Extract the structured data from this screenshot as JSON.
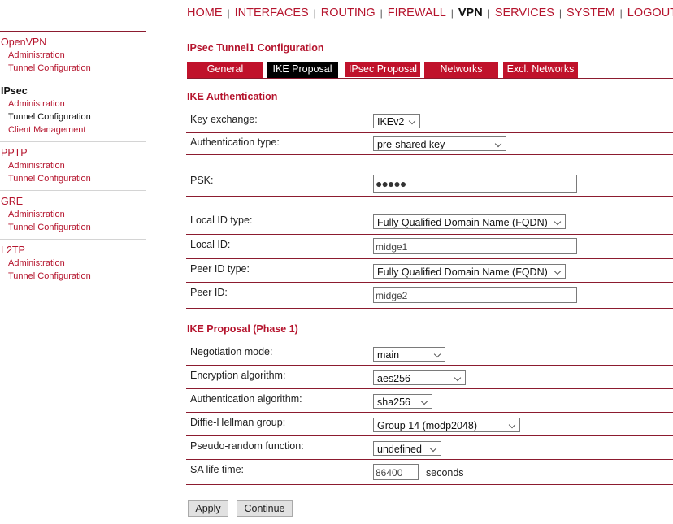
{
  "topnav": {
    "items": [
      {
        "label": "HOME",
        "active": false
      },
      {
        "label": "INTERFACES",
        "active": false
      },
      {
        "label": "ROUTING",
        "active": false
      },
      {
        "label": "FIREWALL",
        "active": false
      },
      {
        "label": "VPN",
        "active": true
      },
      {
        "label": "SERVICES",
        "active": false
      },
      {
        "label": "SYSTEM",
        "active": false
      },
      {
        "label": "LOGOUT",
        "active": false
      }
    ],
    "separator": "|"
  },
  "sidebar": {
    "groups": [
      {
        "title": "OpenVPN",
        "items": [
          "Administration",
          "Tunnel Configuration"
        ]
      },
      {
        "title": "IPsec",
        "items": [
          "Administration",
          "Tunnel Configuration",
          "Client Management"
        ]
      },
      {
        "title": "PPTP",
        "items": [
          "Administration",
          "Tunnel Configuration"
        ]
      },
      {
        "title": "GRE",
        "items": [
          "Administration",
          "Tunnel Configuration"
        ]
      },
      {
        "title": "L2TP",
        "items": [
          "Administration",
          "Tunnel Configuration"
        ]
      }
    ],
    "active_group": "IPsec",
    "active_item": "Tunnel Configuration"
  },
  "page": {
    "title": "IPsec Tunnel1 Configuration",
    "tabs": [
      {
        "label": "General",
        "active": false
      },
      {
        "label": "IKE Proposal",
        "active": true
      },
      {
        "label": "IPsec Proposal",
        "active": false
      },
      {
        "label": "Networks",
        "active": false
      },
      {
        "label": "Excl. Networks",
        "active": false
      }
    ]
  },
  "ike_auth": {
    "title": "IKE Authentication",
    "key_exchange": {
      "label": "Key exchange:",
      "value": "IKEv2"
    },
    "auth_type": {
      "label": "Authentication type:",
      "value": "pre-shared key"
    },
    "psk": {
      "label": "PSK:",
      "masked_value": "●●●●●"
    },
    "local_id_type": {
      "label": "Local ID type:",
      "value": "Fully Qualified Domain Name (FQDN)"
    },
    "local_id": {
      "label": "Local ID:",
      "value": "midge1"
    },
    "peer_id_type": {
      "label": "Peer ID type:",
      "value": "Fully Qualified Domain Name (FQDN)"
    },
    "peer_id": {
      "label": "Peer ID:",
      "value": "midge2"
    }
  },
  "ike_proposal": {
    "title": "IKE Proposal (Phase 1)",
    "negotiation_mode": {
      "label": "Negotiation mode:",
      "value": "main"
    },
    "encryption": {
      "label": "Encryption algorithm:",
      "value": "aes256"
    },
    "authentication": {
      "label": "Authentication algorithm:",
      "value": "sha256"
    },
    "dh_group": {
      "label": "Diffie-Hellman group:",
      "value": "Group 14 (modp2048)"
    },
    "prf": {
      "label": "Pseudo-random function:",
      "value": "undefined"
    },
    "sa_lifetime": {
      "label": "SA life time:",
      "value": "86400",
      "unit": "seconds"
    }
  },
  "buttons": {
    "apply": "Apply",
    "continue": "Continue"
  }
}
